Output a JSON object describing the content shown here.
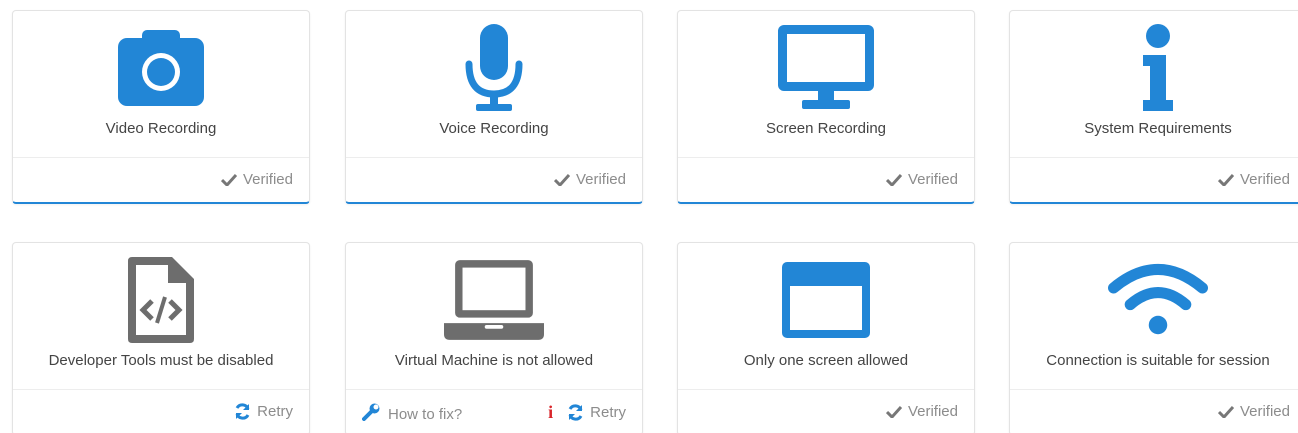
{
  "colors": {
    "accent": "#2286d6",
    "icon_gray": "#6d6d6d",
    "status_gray": "#8c8c8c",
    "error_red": "#d9262b"
  },
  "cards": [
    {
      "label": "Video Recording",
      "icon": "camera-icon",
      "status": "Verified"
    },
    {
      "label": "Voice Recording",
      "icon": "microphone-icon",
      "status": "Verified"
    },
    {
      "label": "Screen Recording",
      "icon": "monitor-icon",
      "status": "Verified"
    },
    {
      "label": "System Requirements",
      "icon": "info-icon",
      "status": "Verified"
    },
    {
      "label": "Developer Tools must be disabled",
      "icon": "code-file-icon",
      "status": "Retry"
    },
    {
      "label": "Virtual Machine is not allowed",
      "icon": "laptop-icon",
      "status": "Retry",
      "fix_label": "How to fix?"
    },
    {
      "label": "Only one screen allowed",
      "icon": "window-icon",
      "status": "Verified"
    },
    {
      "label": "Connection is suitable for session",
      "icon": "wifi-icon",
      "status": "Verified"
    }
  ]
}
